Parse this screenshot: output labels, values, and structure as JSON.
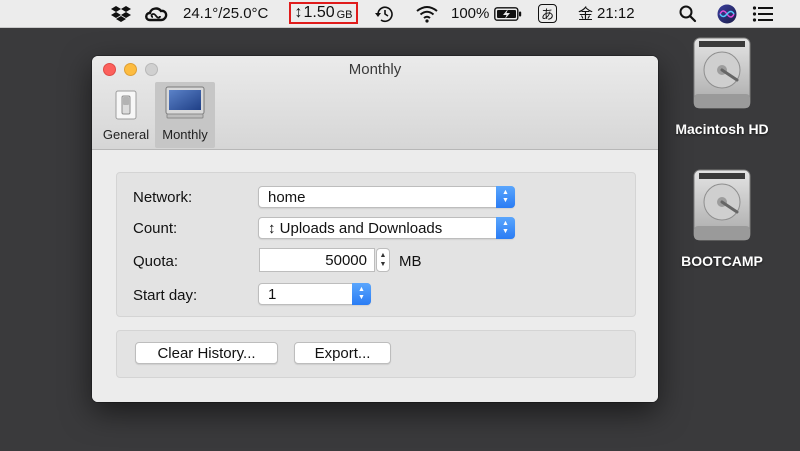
{
  "menubar": {
    "temperature": "24.1°/25.0°C",
    "net_arrow": "↕",
    "net_value": "1.50",
    "net_unit": "GB",
    "battery": "100%",
    "input_method": "あ",
    "day": "金",
    "time": "21:12",
    "highlight_color": "#e01b1b",
    "icons": [
      "dropbox-icon",
      "creative-cloud-icon",
      "time-machine-icon",
      "wifi-icon",
      "battery-charging-icon",
      "spotlight-icon",
      "siri-icon",
      "notification-center-icon"
    ]
  },
  "desktop": {
    "disk1_label": "Macintosh HD",
    "disk2_label": "BOOTCAMP"
  },
  "window": {
    "title": "Monthly",
    "tabs": [
      {
        "label": "General",
        "icon": "switch-icon"
      },
      {
        "label": "Monthly",
        "icon": "monitor-icon"
      }
    ],
    "form": {
      "network_label": "Network:",
      "network_value": "home",
      "count_label": "Count:",
      "count_value": "↕ Uploads and Downloads",
      "quota_label": "Quota:",
      "quota_value": "50000",
      "quota_unit": "MB",
      "startday_label": "Start day:",
      "startday_value": "1"
    },
    "buttons": {
      "clear_history": "Clear History...",
      "export": "Export..."
    }
  }
}
